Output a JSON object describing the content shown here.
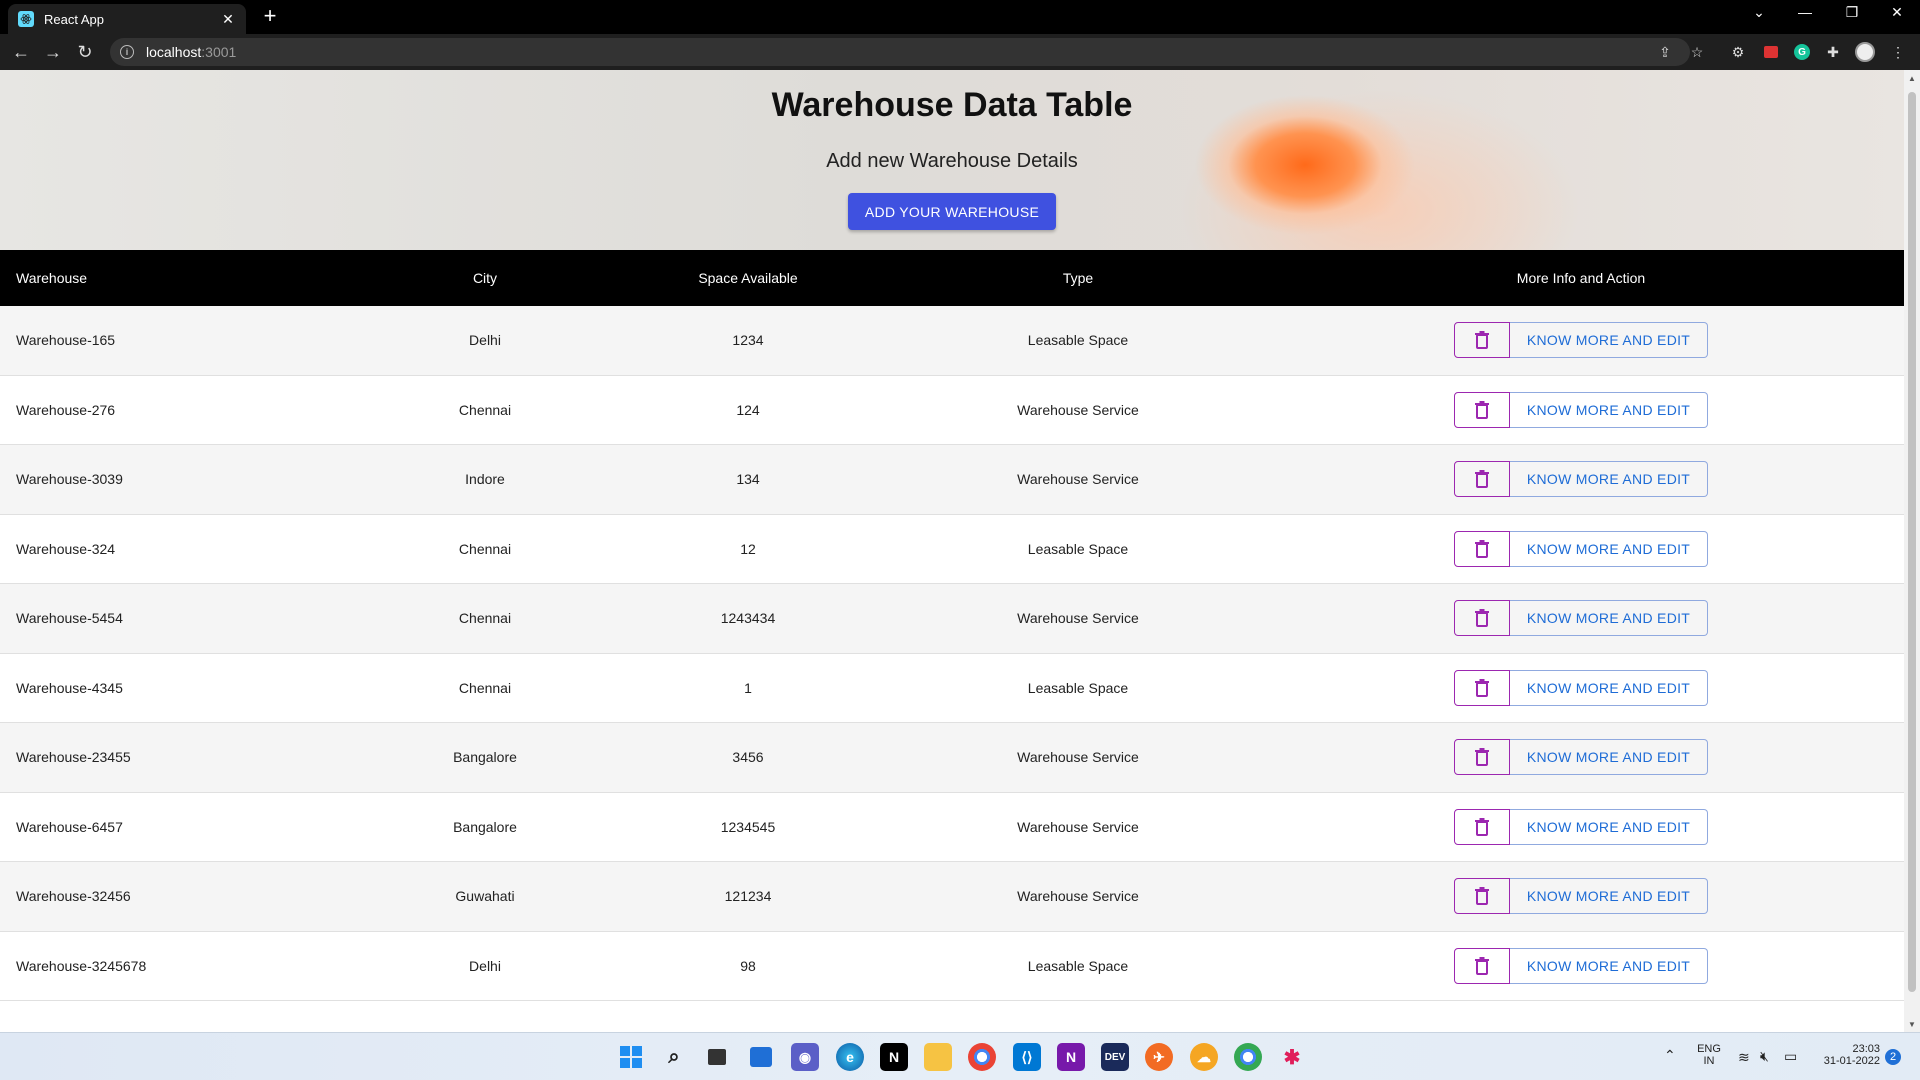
{
  "browser": {
    "tab_title": "React App",
    "url_host": "localhost",
    "url_port": ":3001"
  },
  "page": {
    "title": "Warehouse Data Table",
    "subtitle": "Add new Warehouse Details",
    "add_button": "ADD YOUR WAREHOUSE"
  },
  "table": {
    "headers": [
      "Warehouse",
      "City",
      "Space Available",
      "Type",
      "More Info and Action"
    ],
    "action_label": "KNOW MORE AND EDIT",
    "rows": [
      {
        "warehouse": "Warehouse-165",
        "city": "Delhi",
        "space": "1234",
        "type": "Leasable Space"
      },
      {
        "warehouse": "Warehouse-276",
        "city": "Chennai",
        "space": "124",
        "type": "Warehouse Service"
      },
      {
        "warehouse": "Warehouse-3039",
        "city": "Indore",
        "space": "134",
        "type": "Warehouse Service"
      },
      {
        "warehouse": "Warehouse-324",
        "city": "Chennai",
        "space": "12",
        "type": "Leasable Space"
      },
      {
        "warehouse": "Warehouse-5454",
        "city": "Chennai",
        "space": "1243434",
        "type": "Warehouse Service"
      },
      {
        "warehouse": "Warehouse-4345",
        "city": "Chennai",
        "space": "1",
        "type": "Leasable Space"
      },
      {
        "warehouse": "Warehouse-23455",
        "city": "Bangalore",
        "space": "3456",
        "type": "Warehouse Service"
      },
      {
        "warehouse": "Warehouse-6457",
        "city": "Bangalore",
        "space": "1234545",
        "type": "Warehouse Service"
      },
      {
        "warehouse": "Warehouse-32456",
        "city": "Guwahati",
        "space": "121234",
        "type": "Warehouse Service"
      },
      {
        "warehouse": "Warehouse-3245678",
        "city": "Delhi",
        "space": "98",
        "type": "Leasable Space"
      }
    ]
  },
  "taskbar": {
    "lang": "ENG",
    "region": "IN",
    "time": "23:03",
    "date": "31-01-2022",
    "notifications": "2"
  },
  "colors": {
    "accent": "#3f51e0",
    "delete_outline": "#9c27b0",
    "edit_text": "#1e6cd6",
    "header_bg": "#000000"
  }
}
